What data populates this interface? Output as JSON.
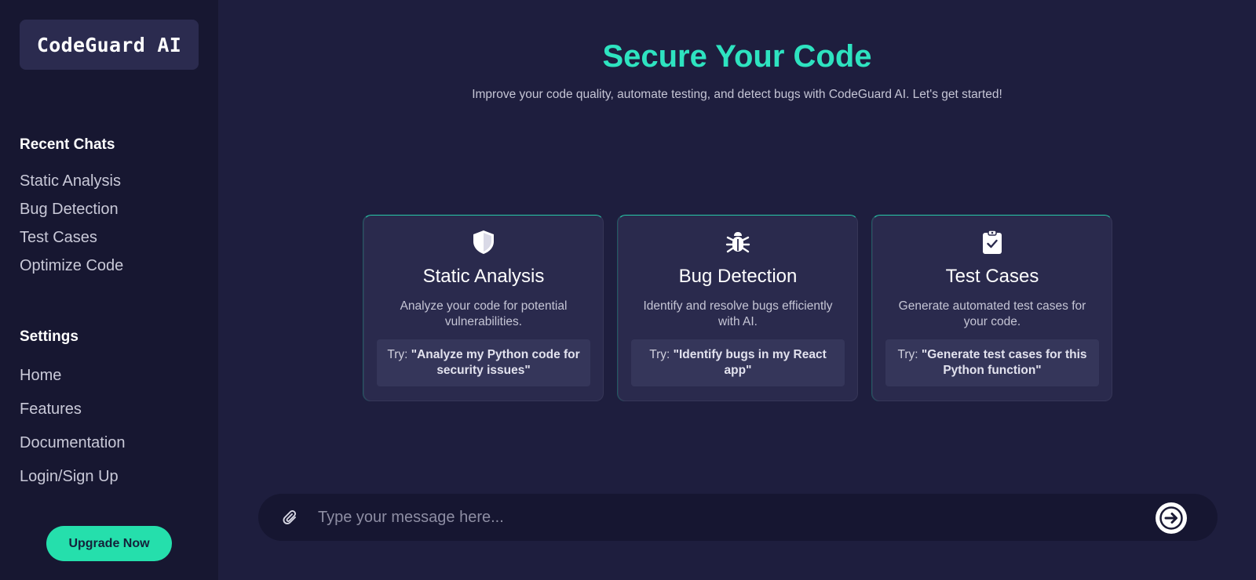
{
  "sidebar": {
    "logo": "CodeGuard AI",
    "recent_title": "Recent Chats",
    "recent_items": [
      {
        "label": "Static Analysis"
      },
      {
        "label": "Bug Detection"
      },
      {
        "label": "Test Cases"
      },
      {
        "label": "Optimize Code"
      }
    ],
    "settings_title": "Settings",
    "settings_items": [
      {
        "label": "Home"
      },
      {
        "label": "Features"
      },
      {
        "label": "Documentation"
      },
      {
        "label": "Login/Sign Up"
      }
    ],
    "upgrade_label": "Upgrade Now"
  },
  "hero": {
    "title": "Secure Your Code",
    "subtitle": "Improve your code quality, automate testing, and detect bugs with CodeGuard AI. Let's get started!"
  },
  "cards": [
    {
      "icon": "shield-icon",
      "title": "Static Analysis",
      "description": "Analyze your code for potential vulnerabilities.",
      "try_prefix": "Try: ",
      "try_text": "\"Analyze my Python code for security issues\""
    },
    {
      "icon": "bug-icon",
      "title": "Bug Detection",
      "description": "Identify and resolve bugs efficiently with AI.",
      "try_prefix": "Try: ",
      "try_text": "\"Identify bugs in my React app\""
    },
    {
      "icon": "clipboard-check-icon",
      "title": "Test Cases",
      "description": "Generate automated test cases for your code.",
      "try_prefix": "Try: ",
      "try_text": "\"Generate test cases for this Python function\""
    }
  ],
  "chat": {
    "placeholder": "Type your message here...",
    "attach_icon": "paperclip-icon",
    "send_icon": "arrow-right-icon"
  },
  "colors": {
    "accent": "#2ee3c0",
    "button": "#25dfac",
    "sidebar_bg": "#171731",
    "main_bg": "#1e1e3e",
    "card_bg": "#2a2a4d"
  }
}
